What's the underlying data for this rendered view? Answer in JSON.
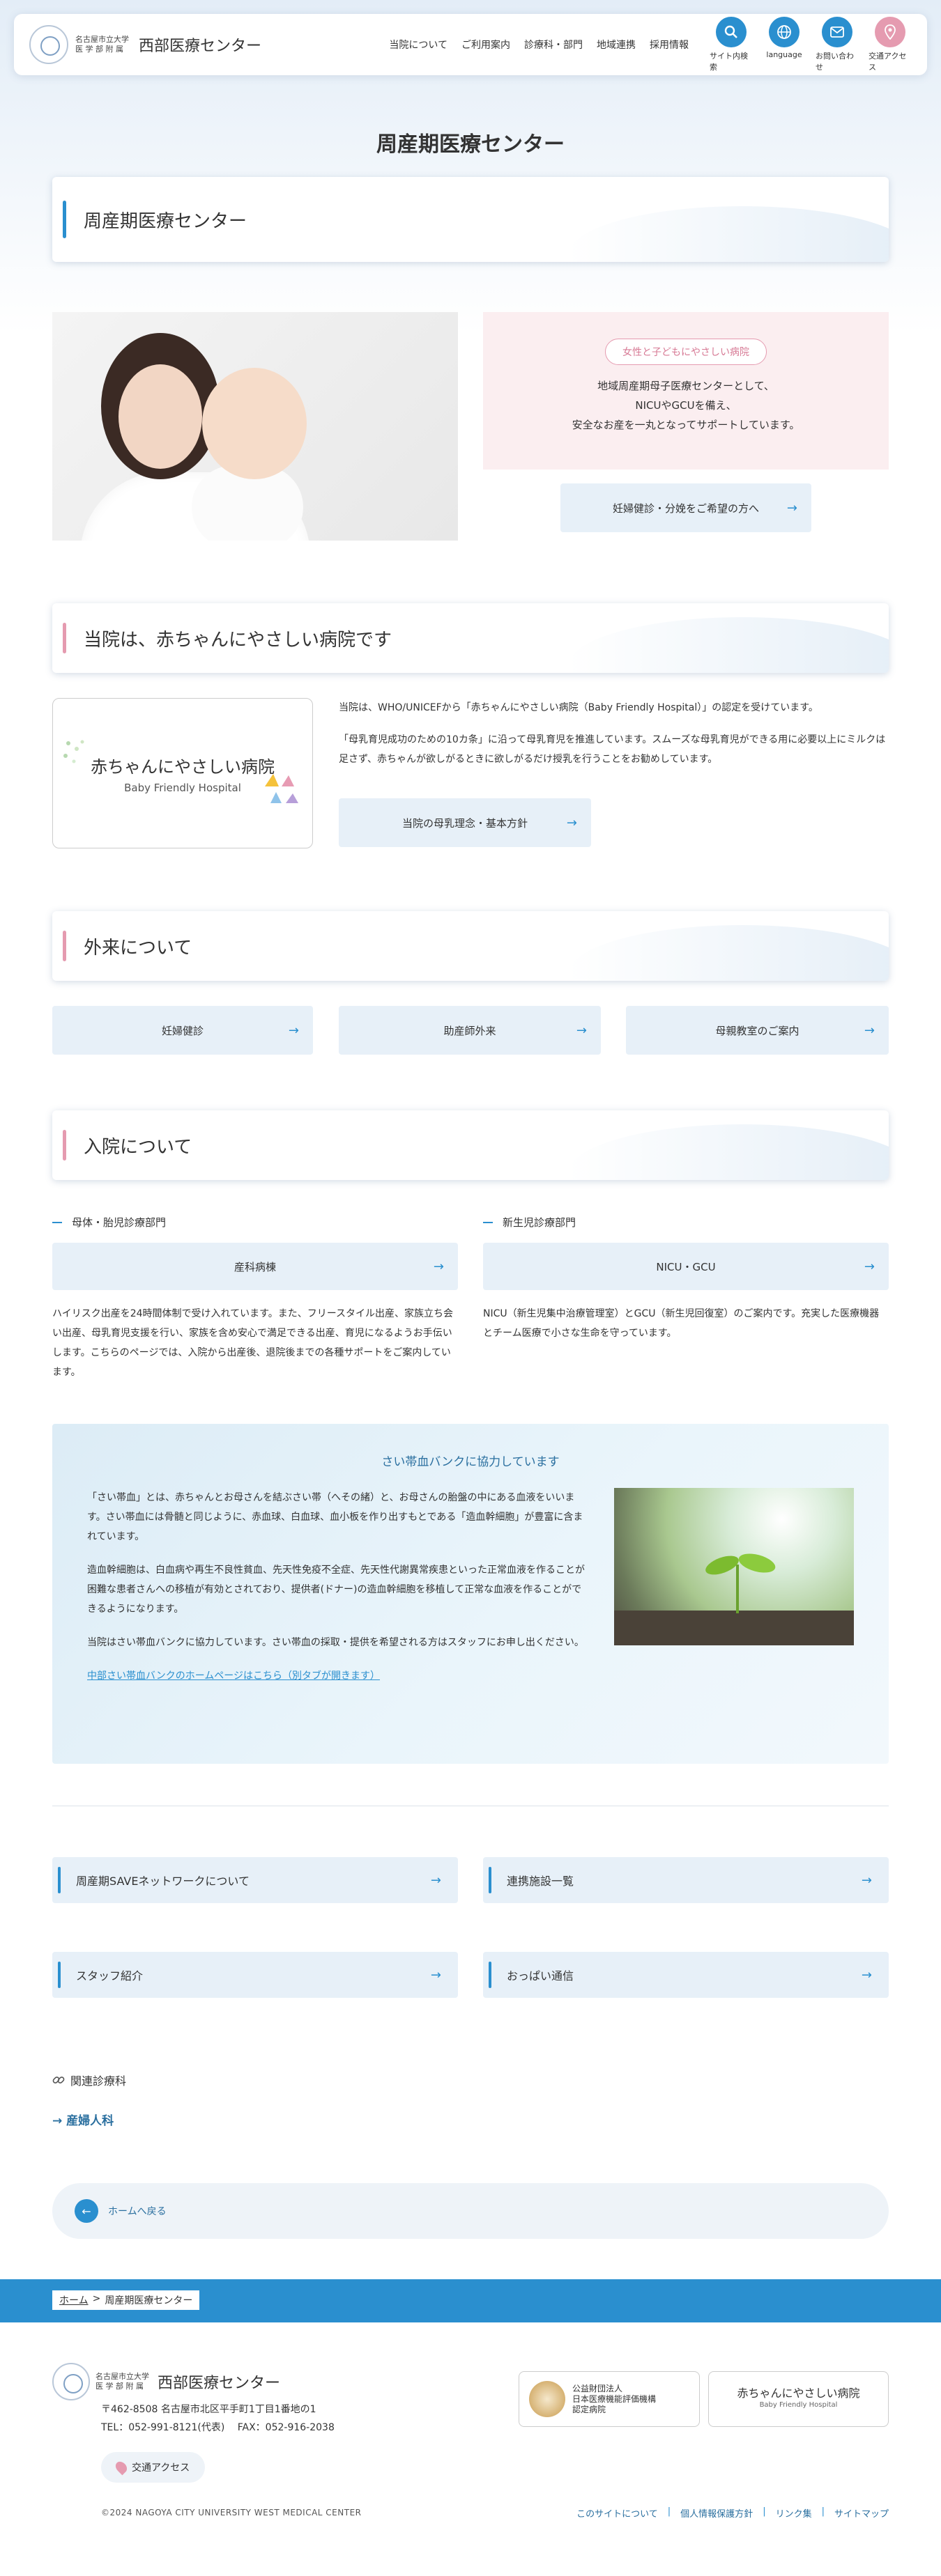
{
  "header": {
    "logo_sub_1": "名古屋市立大学",
    "logo_sub_2": "医 学 部 附 属",
    "logo_main": "西部医療センター",
    "nav": [
      "当院について",
      "ご利用案内",
      "診療科・部門",
      "地域連携",
      "採用情報"
    ],
    "icons": [
      {
        "label": "サイト内検索",
        "icon": "search-icon"
      },
      {
        "label": "language",
        "icon": "globe-icon"
      },
      {
        "label": "お問い合わせ",
        "icon": "mail-icon"
      },
      {
        "label": "交通アクセス",
        "icon": "map-pin-icon"
      }
    ]
  },
  "page_title": "周産期医療センター",
  "title_box": "周産期医療センター",
  "hero": {
    "pill": "女性と子どもにやさしい病院",
    "line1": "地域周産期母子医療センターとして、",
    "line2": "NICUやGCUを備え、",
    "line3": "安全なお産を一丸となってサポートしています。",
    "button": "妊婦健診・分娩をご希望の方へ"
  },
  "bfh": {
    "heading": "当院は、赤ちゃんにやさしい病院です",
    "card_title": "赤ちゃんにやさしい病院",
    "card_sub": "Baby Friendly Hospital",
    "text1": "当院は、WHO/UNICEFから「赤ちゃんにやさしい病院（Baby Friendly Hospital）」の認定を受けています。",
    "text2": "「母乳育児成功のための10カ条」に沿って母乳育児を推進しています。スムーズな母乳育児ができる用に必要以上にミルクは足さず、赤ちゃんが欲しがるときに欲しがるだけ授乳を行うことをお勧めしています。",
    "button": "当院の母乳理念・基本方針"
  },
  "outpatient": {
    "heading": "外来について",
    "buttons": [
      "妊婦健診",
      "助産師外来",
      "母親教室のご案内"
    ]
  },
  "inpatient": {
    "heading": "入院について",
    "left_sub": "母体・胎児診療部門",
    "left_button": "産科病棟",
    "left_desc": "ハイリスク出産を24時間体制で受け入れています。また、フリースタイル出産、家族立ち会い出産、母乳育児支援を行い、家族を含め安心で満足できる出産、育児になるようお手伝いします。こちらのページでは、入院から出産後、退院後までの各種サポートをご案内しています。",
    "right_sub": "新生児診療部門",
    "right_button": "NICU・GCU",
    "right_desc": "NICU（新生児集中治療管理室）とGCU（新生児回復室）のご案内です。充実した医療機器とチーム医療で小さな生命を守っています。"
  },
  "cord": {
    "title": "さい帯血バンクに協力しています",
    "p1": "「さい帯血」とは、赤ちゃんとお母さんを結ぶさい帯（へその緒）と、お母さんの胎盤の中にある血液をいいます。さい帯血には骨髄と同じように、赤血球、白血球、血小板を作り出すもとである「造血幹細胞」が豊富に含まれています。",
    "p2": "造血幹細胞は、白血病や再生不良性貧血、先天性免疫不全症、先天性代謝異常疾患といった正常血液を作ることが困難な患者さんへの移植が有効とされており、提供者(ドナー)の造血幹細胞を移植して正常な血液を作ることができるようになります。",
    "p3": "当院はさい帯血バンクに協力しています。さい帯血の採取・提供を希望される方はスタッフにお申し出ください。",
    "link": "中部さい帯血バンクのホームページはこちら（別タブが開きます）"
  },
  "links": [
    "周産期SAVEネットワークについて",
    "連携施設一覧",
    "スタッフ紹介",
    "おっぱい通信"
  ],
  "related": {
    "label": "関連診療科",
    "link": "→ 産婦人科"
  },
  "back": "ホームへ戻る",
  "breadcrumb": {
    "home": "ホーム",
    "sep": ">",
    "current": "周産期医療センター"
  },
  "footer": {
    "logo_main": "西部医療センター",
    "address": "〒462-8508 名古屋市北区平手町1丁目1番地の1",
    "tel": "TEL：052-991-8121(代表)　 FAX：052-916-2038",
    "access": "交通アクセス",
    "banner1_l1": "公益財団法人",
    "banner1_l2": "日本医療機能評価機構",
    "banner1_l3": "認定病院",
    "banner2_title": "赤ちゃんにやさしい病院",
    "banner2_sub": "Baby Friendly Hospital",
    "copyright": "©2024 NAGOYA CITY UNIVERSITY WEST MEDICAL CENTER",
    "links": [
      "このサイトについて",
      "個人情報保護方針",
      "リンク集",
      "サイトマップ"
    ]
  }
}
